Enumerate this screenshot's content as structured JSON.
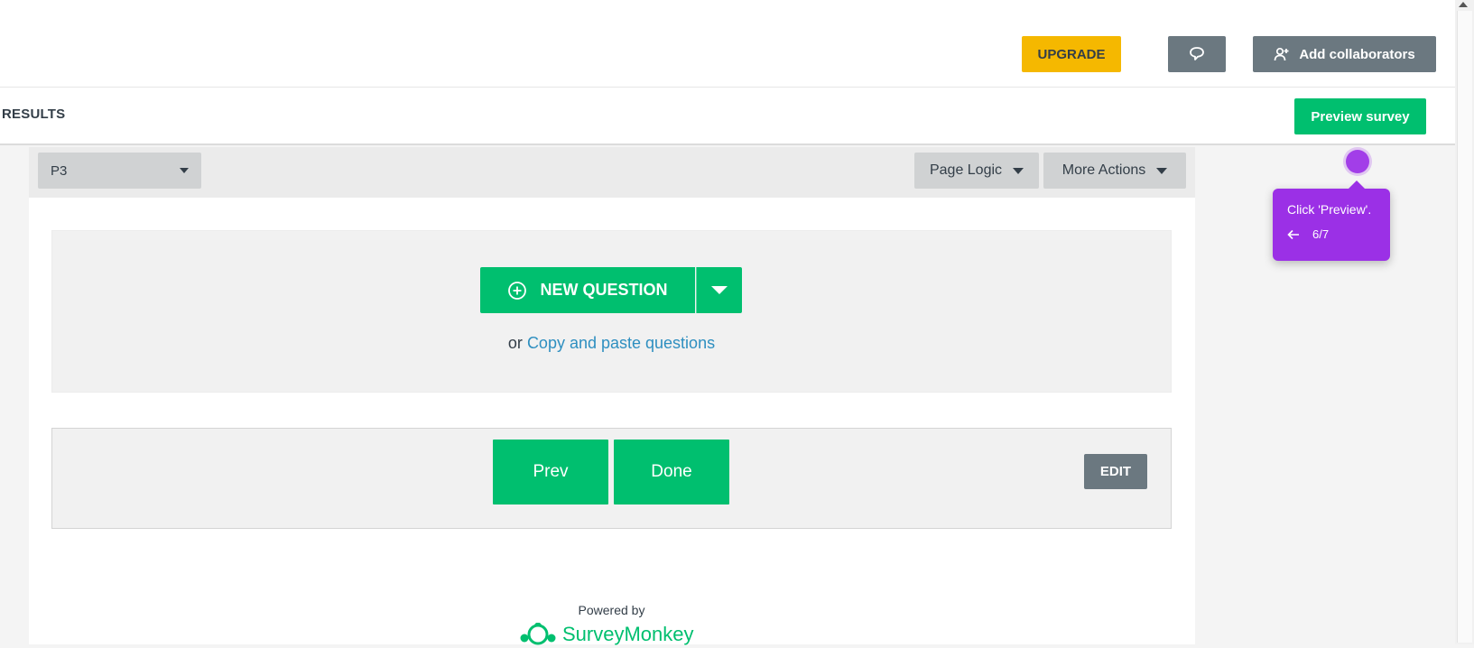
{
  "header": {
    "upgrade_label": "UPGRADE",
    "feedback_icon": "speech-bubble-icon",
    "collaborators_label": "Add collaborators"
  },
  "nav": {
    "results_label": "RESULTS",
    "preview_label": "Preview survey"
  },
  "page_toolbar": {
    "page_selected": "P3",
    "page_logic_label": "Page Logic",
    "more_actions_label": "More Actions"
  },
  "question_block": {
    "new_question_label": "NEW QUESTION",
    "or_text": "or",
    "copy_paste_label": "Copy and paste questions"
  },
  "nav_buttons": {
    "prev_label": "Prev",
    "done_label": "Done",
    "edit_label": "EDIT"
  },
  "footer": {
    "powered_by": "Powered by",
    "brand": "SurveyMonkey"
  },
  "tooltip": {
    "text": "Click 'Preview'.",
    "step": "6/7"
  },
  "colors": {
    "primary_green": "#00bf6f",
    "upgrade_yellow": "#f5b800",
    "gray_button": "#6b7880",
    "tooltip_purple": "#9b30e6",
    "link_blue": "#2e8fc0"
  }
}
